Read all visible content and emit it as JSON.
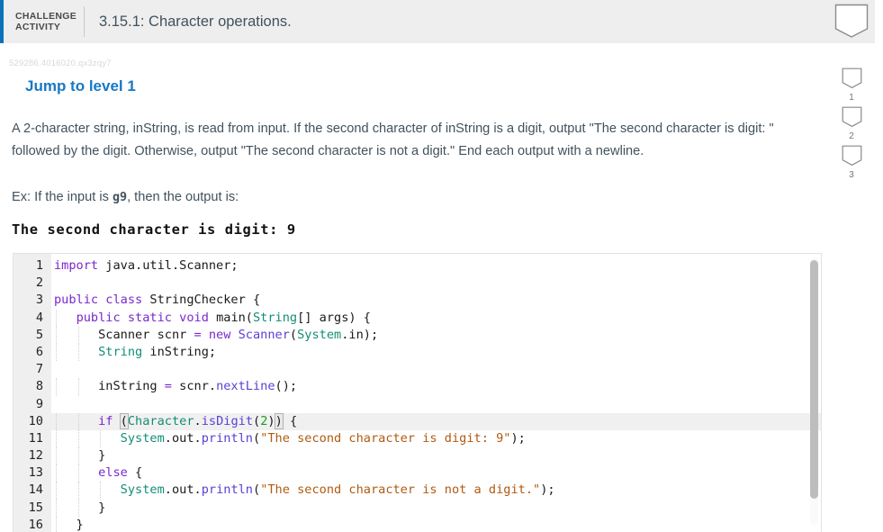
{
  "header": {
    "kicker": "CHALLENGE ACTIVITY",
    "title": "3.15.1: Character operations.",
    "accent_color": "#0b72b9",
    "background": "#eeeeee",
    "pennant_icon": "pennant-icon"
  },
  "rail": {
    "items": [
      {
        "label": "1",
        "icon": "pennant-icon"
      },
      {
        "label": "2",
        "icon": "pennant-icon"
      },
      {
        "label": "3",
        "icon": "pennant-icon"
      }
    ]
  },
  "content": {
    "activity_id": "529286.4016020.qx3zqy7",
    "level_heading": "Jump to level 1",
    "level_heading_color": "#1878c4",
    "prompt": "A 2-character string, inString, is read from input. If the second character of inString is a digit, output \"The second character is digit: \" followed by the digit. Otherwise, output \"The second character is not a digit.\" End each output with a newline.",
    "example_prefix": "Ex: If the input is ",
    "example_input": "g9",
    "example_suffix": ", then the output is:",
    "sample_output": "The second character is digit: 9"
  },
  "editor": {
    "language": "java",
    "active_line": 10,
    "lines": [
      {
        "n": "1",
        "tokens": [
          {
            "t": "import",
            "c": "kw"
          },
          {
            "t": " java.util.Scanner;",
            "c": ""
          }
        ]
      },
      {
        "n": "2",
        "tokens": []
      },
      {
        "n": "3",
        "tokens": [
          {
            "t": "public class",
            "c": "kw"
          },
          {
            "t": " StringChecker {",
            "c": ""
          }
        ]
      },
      {
        "n": "4",
        "tokens": [
          {
            "t": "   ",
            "c": ""
          },
          {
            "t": "public static void",
            "c": "kw"
          },
          {
            "t": " main(",
            "c": ""
          },
          {
            "t": "String",
            "c": "typ"
          },
          {
            "t": "[] args) {",
            "c": ""
          }
        ]
      },
      {
        "n": "5",
        "tokens": [
          {
            "t": "      Scanner scnr ",
            "c": ""
          },
          {
            "t": "=",
            "c": "kw"
          },
          {
            "t": " ",
            "c": ""
          },
          {
            "t": "new",
            "c": "kw"
          },
          {
            "t": " ",
            "c": ""
          },
          {
            "t": "Scanner",
            "c": "fn"
          },
          {
            "t": "(",
            "c": ""
          },
          {
            "t": "System",
            "c": "typ"
          },
          {
            "t": ".in);",
            "c": ""
          }
        ]
      },
      {
        "n": "6",
        "tokens": [
          {
            "t": "      ",
            "c": ""
          },
          {
            "t": "String",
            "c": "typ"
          },
          {
            "t": " inString;",
            "c": ""
          }
        ]
      },
      {
        "n": "7",
        "tokens": []
      },
      {
        "n": "8",
        "tokens": [
          {
            "t": "      inString ",
            "c": ""
          },
          {
            "t": "=",
            "c": "kw"
          },
          {
            "t": " scnr.",
            "c": ""
          },
          {
            "t": "nextLine",
            "c": "fn"
          },
          {
            "t": "();",
            "c": ""
          }
        ]
      },
      {
        "n": "9",
        "tokens": []
      },
      {
        "n": "10",
        "tokens": [
          {
            "t": "      ",
            "c": ""
          },
          {
            "t": "if",
            "c": "kw"
          },
          {
            "t": " ",
            "c": ""
          },
          {
            "t": "(",
            "c": "br"
          },
          {
            "t": "Character",
            "c": "typ"
          },
          {
            "t": ".",
            "c": ""
          },
          {
            "t": "isDigit",
            "c": "fn"
          },
          {
            "t": "(",
            "c": ""
          },
          {
            "t": "2",
            "c": "num"
          },
          {
            "t": ")",
            "c": ""
          },
          {
            "t": ")",
            "c": "br"
          },
          {
            "t": " {",
            "c": ""
          }
        ]
      },
      {
        "n": "11",
        "tokens": [
          {
            "t": "         ",
            "c": ""
          },
          {
            "t": "System",
            "c": "typ"
          },
          {
            "t": ".out.",
            "c": ""
          },
          {
            "t": "println",
            "c": "fn"
          },
          {
            "t": "(",
            "c": ""
          },
          {
            "t": "\"The second character is digit: 9\"",
            "c": "str"
          },
          {
            "t": ");",
            "c": ""
          }
        ]
      },
      {
        "n": "12",
        "tokens": [
          {
            "t": "      }",
            "c": ""
          }
        ]
      },
      {
        "n": "13",
        "tokens": [
          {
            "t": "      ",
            "c": ""
          },
          {
            "t": "else",
            "c": "kw"
          },
          {
            "t": " {",
            "c": ""
          }
        ]
      },
      {
        "n": "14",
        "tokens": [
          {
            "t": "         ",
            "c": ""
          },
          {
            "t": "System",
            "c": "typ"
          },
          {
            "t": ".out.",
            "c": ""
          },
          {
            "t": "println",
            "c": "fn"
          },
          {
            "t": "(",
            "c": ""
          },
          {
            "t": "\"The second character is not a digit.\"",
            "c": "str"
          },
          {
            "t": ");",
            "c": ""
          }
        ]
      },
      {
        "n": "15",
        "tokens": [
          {
            "t": "      }",
            "c": ""
          }
        ]
      },
      {
        "n": "16",
        "tokens": [
          {
            "t": "   }",
            "c": ""
          }
        ]
      }
    ]
  }
}
